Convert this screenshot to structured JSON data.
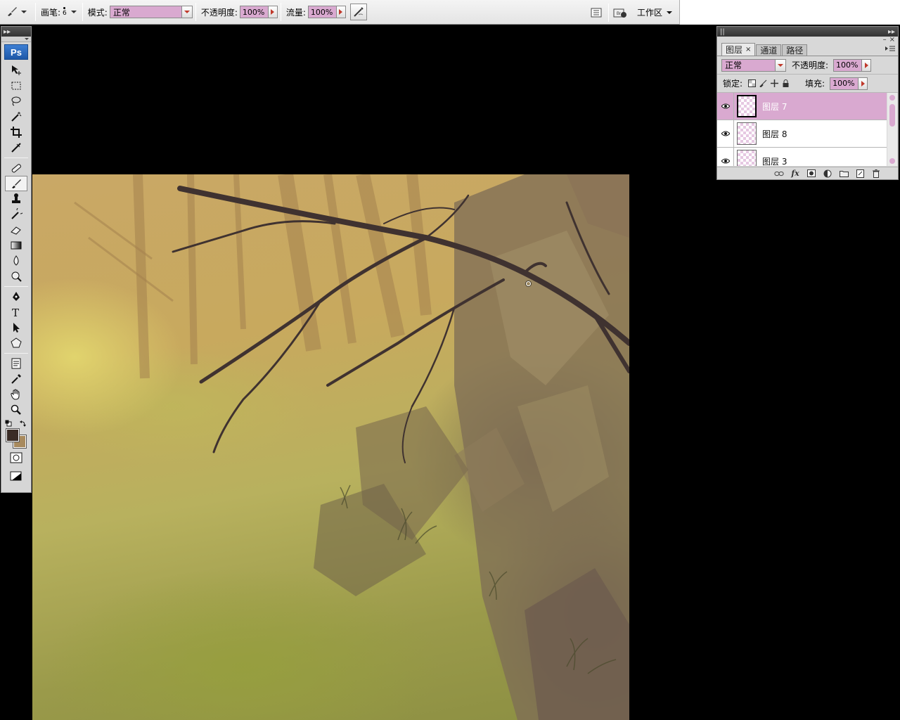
{
  "options_bar": {
    "brush_label": "画笔:",
    "brush_size": "6",
    "mode_label": "模式:",
    "mode_value": "正常",
    "opacity_label": "不透明度:",
    "opacity_value": "100%",
    "flow_label": "流量:",
    "flow_value": "100%",
    "workspace_label": "工作区"
  },
  "tools": [
    "move-tool",
    "marquee-tool",
    "lasso-tool",
    "magic-wand-tool",
    "crop-tool",
    "slice-tool",
    "healing-brush-tool",
    "brush-tool",
    "clone-stamp-tool",
    "history-brush-tool",
    "eraser-tool",
    "gradient-tool",
    "blur-tool",
    "dodge-tool",
    "pen-tool",
    "type-tool",
    "path-selection-tool",
    "custom-shape-tool",
    "notes-tool",
    "eyedropper-tool",
    "hand-tool",
    "zoom-tool"
  ],
  "colors": {
    "foreground": "#3a2c26",
    "background": "#a88a5e",
    "accent": "#d9a9d0"
  },
  "layers_panel": {
    "tabs": [
      {
        "label": "图层"
      },
      {
        "label": "通道"
      },
      {
        "label": "路径"
      }
    ],
    "blend_mode": "正常",
    "opacity_label": "不透明度:",
    "opacity_value": "100%",
    "lock_label": "锁定:",
    "fill_label": "填充:",
    "fill_value": "100%",
    "layers": [
      {
        "name": "图层 7",
        "selected": true
      },
      {
        "name": "图层 8",
        "selected": false
      },
      {
        "name": "图层 3",
        "selected": false
      }
    ]
  }
}
